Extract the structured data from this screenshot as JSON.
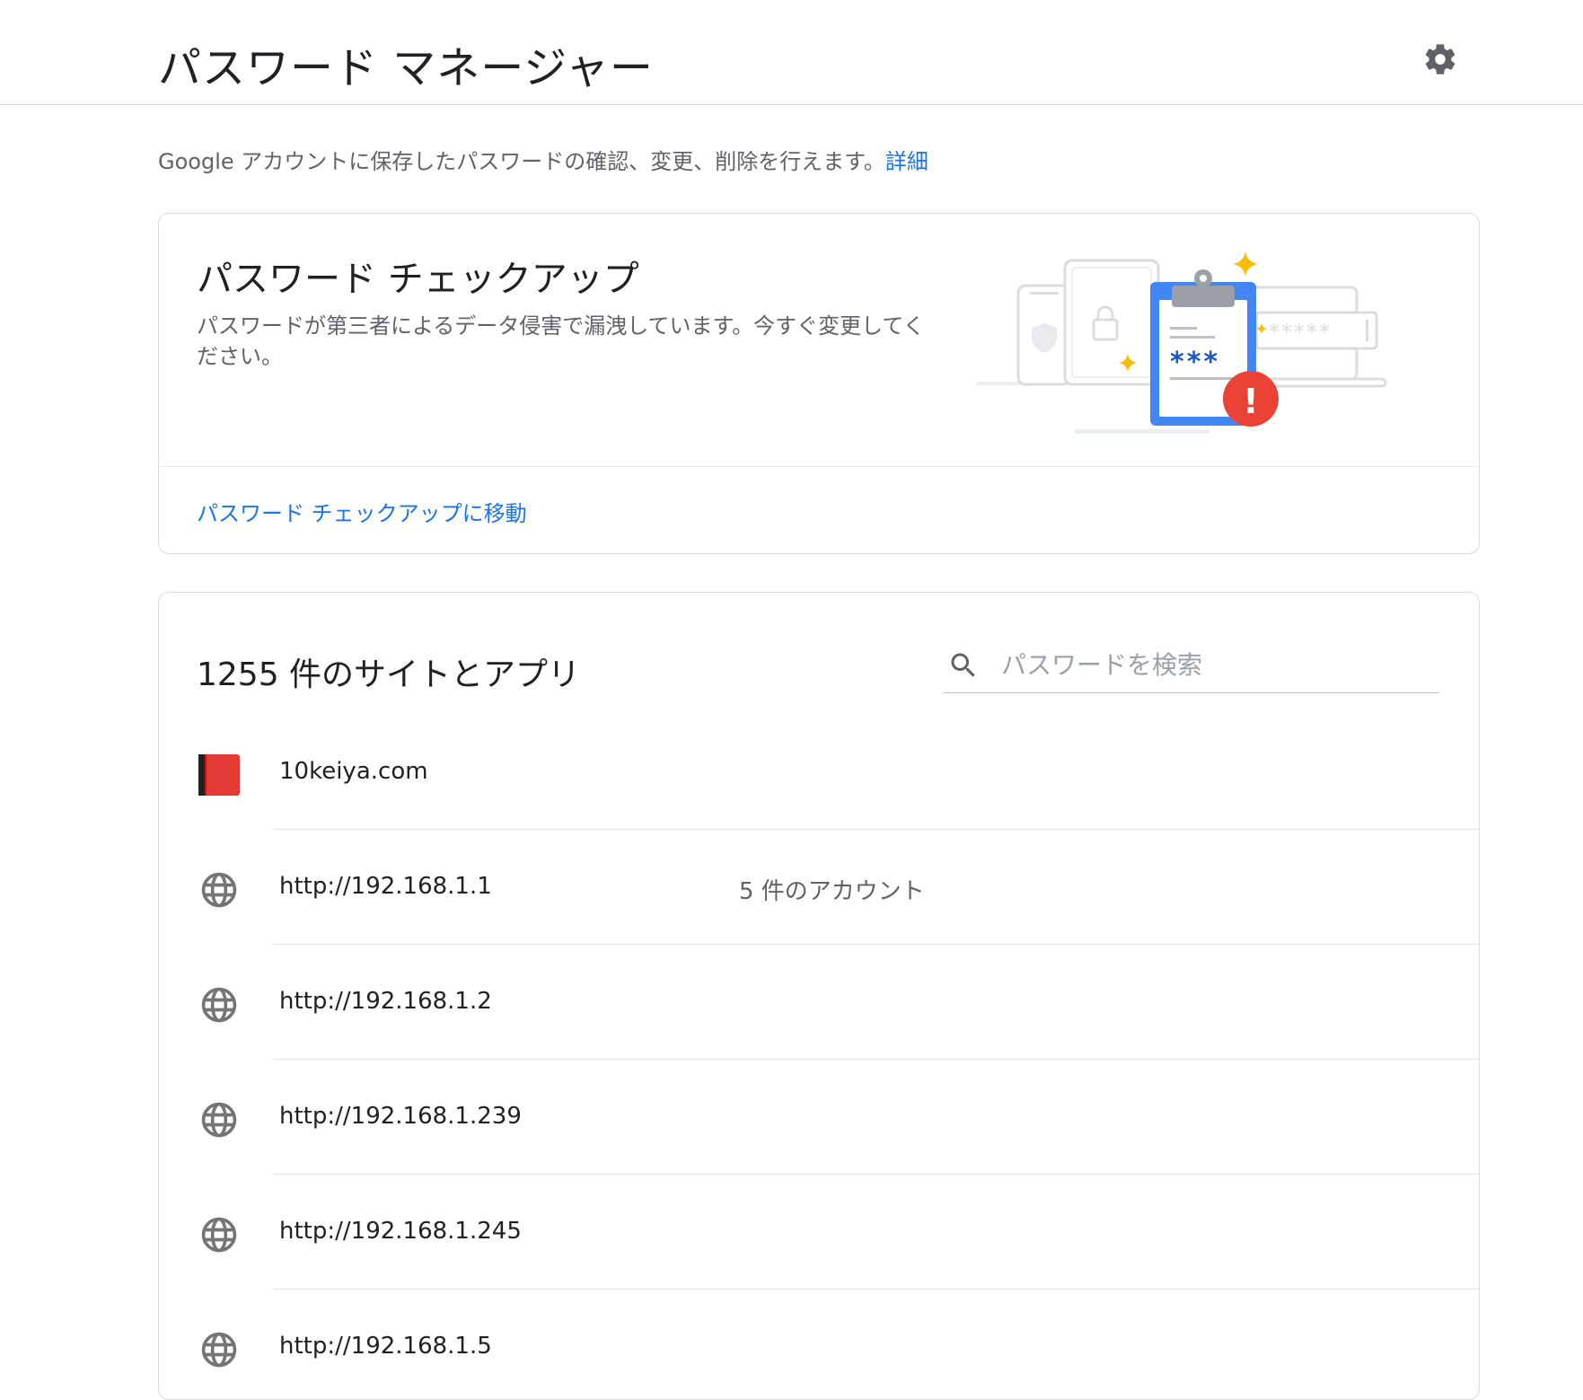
{
  "header": {
    "title": "パスワード マネージャー",
    "settings_icon": "gear-icon"
  },
  "intro": {
    "text": "Google アカウントに保存したパスワードの確認、変更、削除を行えます。",
    "link": "詳細"
  },
  "checkup": {
    "title": "パスワード チェックアップ",
    "description": "パスワードが第三者によるデータ侵害で漏洩しています。今すぐ変更してください。",
    "link": "パスワード チェックアップに移動",
    "illustration": {
      "clipboard_text": "***",
      "password_field_text": "*****",
      "alert_mark": "!",
      "colors": {
        "blue": "#4285f4",
        "red": "#ea4335",
        "yellow": "#fbbc04",
        "gray": "#dadce0"
      }
    }
  },
  "list": {
    "title": "1255 件のサイトとアプリ",
    "search_placeholder": "パスワードを検索",
    "search_icon": "search-icon",
    "rows": [
      {
        "site": "10keiya.com",
        "accounts": "",
        "icon": "red-book-favicon"
      },
      {
        "site": "http://192.168.1.1",
        "accounts": "5 件のアカウント",
        "icon": "globe-icon"
      },
      {
        "site": "http://192.168.1.2",
        "accounts": "",
        "icon": "globe-icon"
      },
      {
        "site": "http://192.168.1.239",
        "accounts": "",
        "icon": "globe-icon"
      },
      {
        "site": "http://192.168.1.245",
        "accounts": "",
        "icon": "globe-icon"
      },
      {
        "site": "http://192.168.1.5",
        "accounts": "",
        "icon": "globe-icon"
      }
    ]
  },
  "colors": {
    "link": "#1a73e8",
    "text_primary": "#202124",
    "text_secondary": "#5f6368",
    "border": "#dadce0"
  }
}
